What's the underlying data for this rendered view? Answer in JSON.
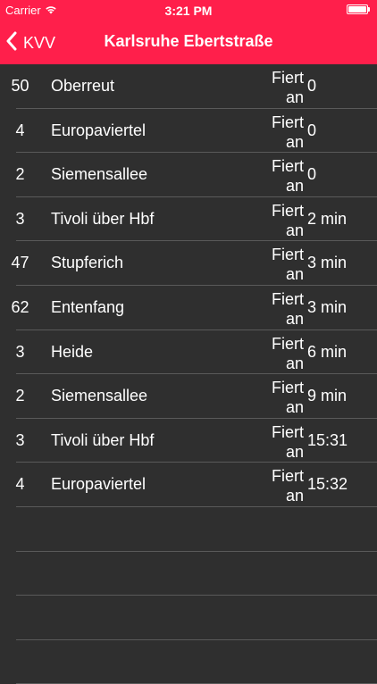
{
  "statusbar": {
    "carrier": "Carrier",
    "time": "3:21 PM",
    "wifi_icon": "wifi-icon",
    "battery_icon": "battery-icon"
  },
  "navbar": {
    "back_label": "KVV",
    "title": "Karlsruhe Ebertstraße",
    "accent_color": "#ff1f4b"
  },
  "departures": [
    {
      "line": "50",
      "destination": "Oberreut",
      "status_line1": "Fiert",
      "status_line2": "an",
      "time": "0"
    },
    {
      "line": "4",
      "destination": "Europaviertel",
      "status_line1": "Fiert",
      "status_line2": "an",
      "time": "0"
    },
    {
      "line": "2",
      "destination": "Siemensallee",
      "status_line1": "Fiert",
      "status_line2": "an",
      "time": "0"
    },
    {
      "line": "3",
      "destination": "Tivoli über Hbf",
      "status_line1": "Fiert",
      "status_line2": "an",
      "time": "2 min"
    },
    {
      "line": "47",
      "destination": "Stupferich",
      "status_line1": "Fiert",
      "status_line2": "an",
      "time": "3 min"
    },
    {
      "line": "62",
      "destination": "Entenfang",
      "status_line1": "Fiert",
      "status_line2": "an",
      "time": "3 min"
    },
    {
      "line": "3",
      "destination": "Heide",
      "status_line1": "Fiert",
      "status_line2": "an",
      "time": "6 min"
    },
    {
      "line": "2",
      "destination": "Siemensallee",
      "status_line1": "Fiert",
      "status_line2": "an",
      "time": "9 min"
    },
    {
      "line": "3",
      "destination": "Tivoli über Hbf",
      "status_line1": "Fiert",
      "status_line2": "an",
      "time": "15:31"
    },
    {
      "line": "4",
      "destination": "Europaviertel",
      "status_line1": "Fiert",
      "status_line2": "an",
      "time": "15:32"
    }
  ]
}
